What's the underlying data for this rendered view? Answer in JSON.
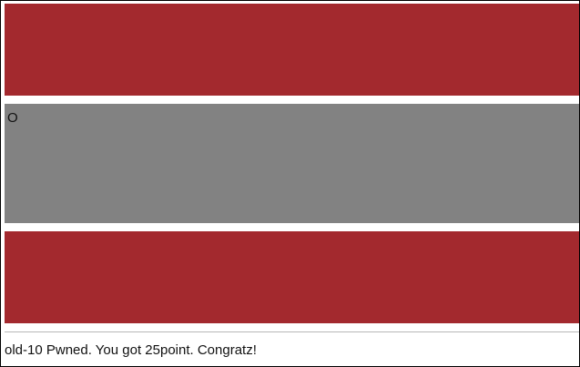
{
  "page": {
    "bands": [
      {
        "name": "band-top",
        "color": "#a3292e"
      },
      {
        "name": "band-middle",
        "color": "#828282",
        "text": "O"
      },
      {
        "name": "band-bottom",
        "color": "#a3292e"
      }
    ],
    "divider_color": "#b8b8b8",
    "message": "old-10 Pwned. You got 25point. Congratz!"
  }
}
